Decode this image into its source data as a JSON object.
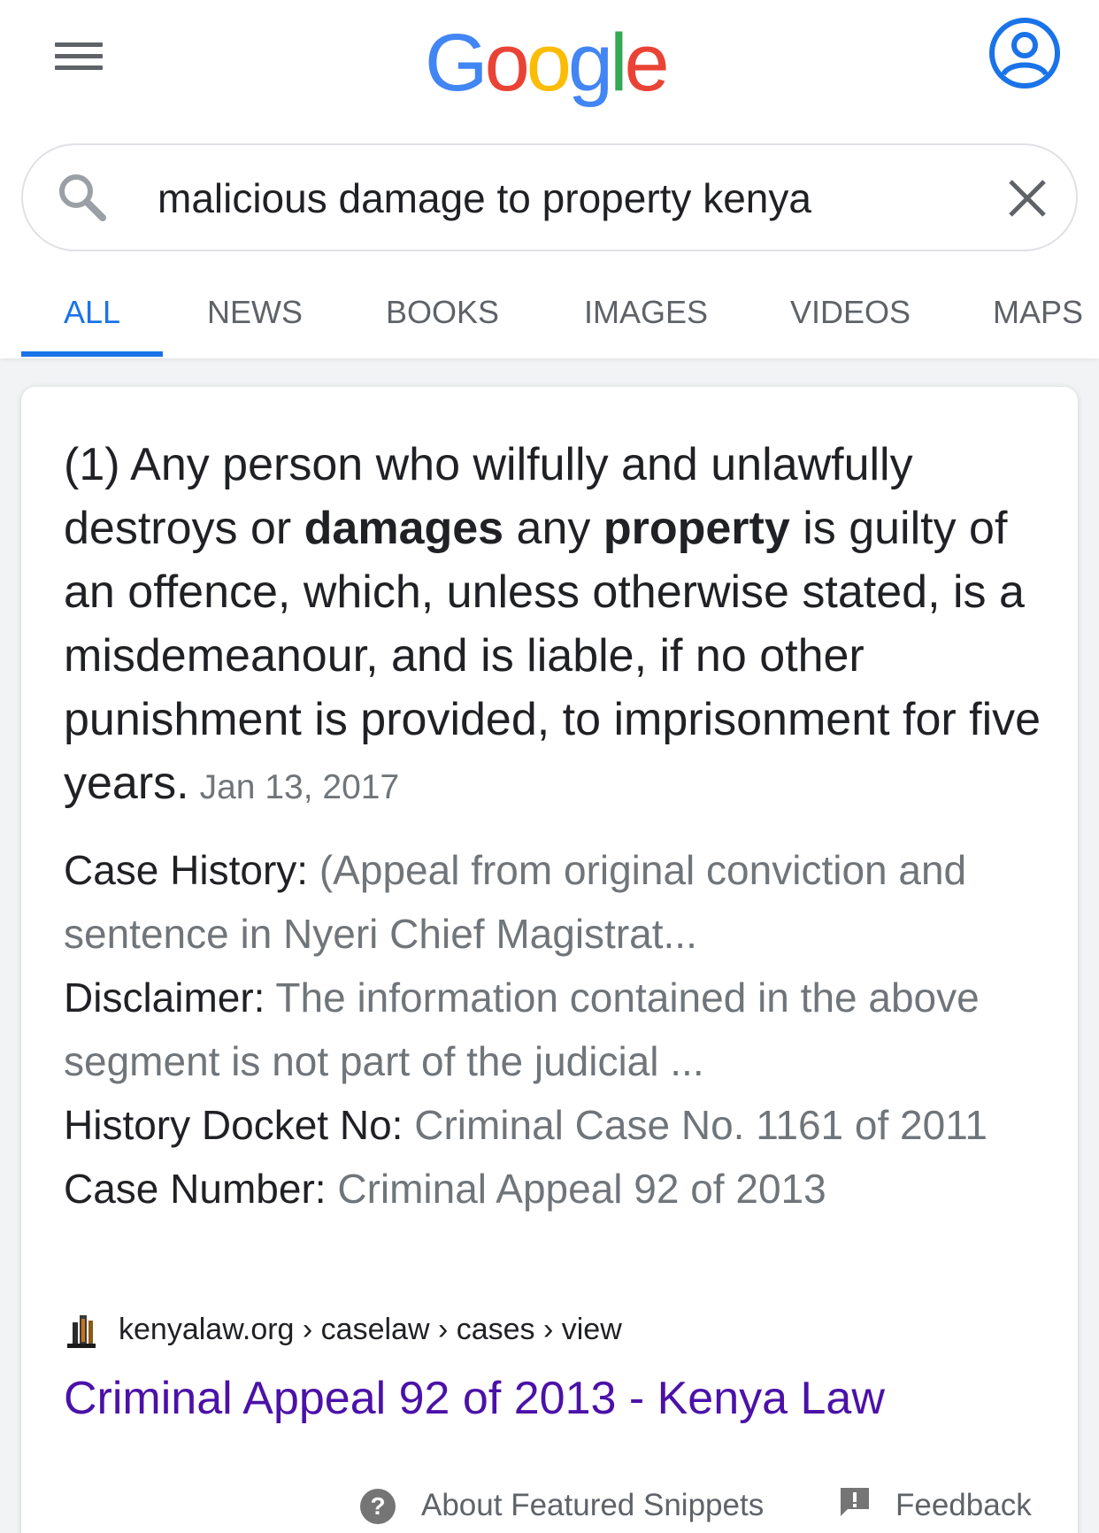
{
  "header": {
    "logo_letters": [
      "G",
      "o",
      "o",
      "g",
      "l",
      "e"
    ],
    "logo_colors": [
      "#4285f4",
      "#ea4335",
      "#fbbc05",
      "#4285f4",
      "#34a853",
      "#ea4335"
    ],
    "menu_icon": "hamburger-menu-icon",
    "account_icon": "account-circle-icon"
  },
  "search": {
    "query": "malicious damage to property kenya",
    "search_icon": "search-icon",
    "clear_icon": "close-icon"
  },
  "tabs": [
    {
      "label": "ALL",
      "active": true
    },
    {
      "label": "NEWS",
      "active": false
    },
    {
      "label": "BOOKS",
      "active": false
    },
    {
      "label": "IMAGES",
      "active": false
    },
    {
      "label": "VIDEOS",
      "active": false
    },
    {
      "label": "MAPS",
      "active": false
    }
  ],
  "snippet": {
    "part1": "(1) Any person who wilfully and unlawfully destroys or ",
    "bold1": "damages",
    "part2": " any ",
    "bold2": "property",
    "part3": " is guilty of an offence, which, unless otherwise stated, is a misdemeanour, and is liable, if no other punishment is provided, to imprisonment for five years.",
    "date": "Jan 13, 2017"
  },
  "facts": [
    {
      "label": "Case History:",
      "value": "(Appeal from original conviction and sentence in Nyeri Chief Magistrat..."
    },
    {
      "label": "Disclaimer:",
      "value": "The information contained in the above segment is not part of the judicial ..."
    },
    {
      "label": "History Docket No:",
      "value": "Criminal Case No. 1161 of 2011"
    },
    {
      "label": "Case Number:",
      "value": "Criminal Appeal 92 of 2013"
    }
  ],
  "result": {
    "breadcrumb": "kenyalaw.org › caselaw › cases › view",
    "title": "Criminal Appeal 92 of 2013 - Kenya Law",
    "title_color": "#4b11a8"
  },
  "footer": {
    "about_label": "About Featured Snippets",
    "feedback_label": "Feedback",
    "help_icon": "help-circle-icon",
    "feedback_icon": "feedback-icon"
  }
}
